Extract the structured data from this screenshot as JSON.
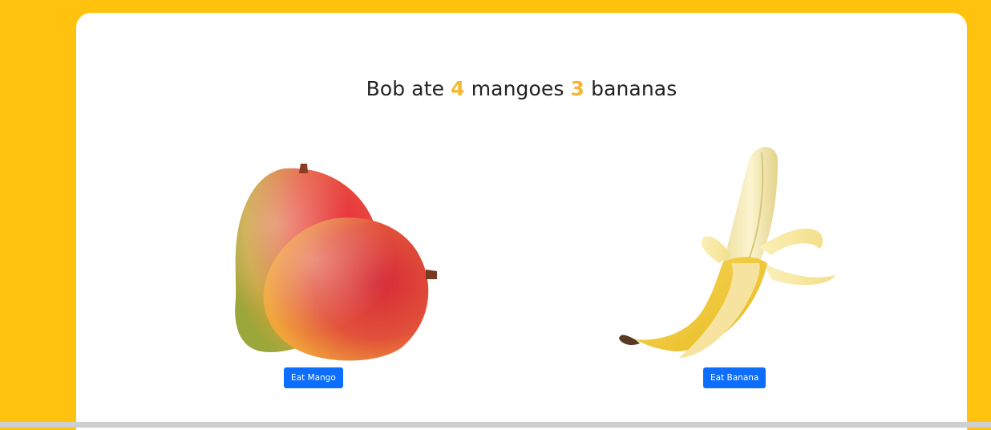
{
  "headline": {
    "part_1": "Bob ate",
    "mango_count": "4",
    "part_2": "mangoes",
    "banana_count": "3",
    "part_3": "bananas"
  },
  "mango": {
    "button_label": "Eat Mango",
    "image_icon": "mango-icon"
  },
  "banana": {
    "button_label": "Eat Banana",
    "image_icon": "banana-icon"
  },
  "colors": {
    "page_background": "#FFC20E",
    "card_background": "#FFFFFF",
    "count_accent": "#F4B731",
    "button": "#0D6EFD"
  }
}
